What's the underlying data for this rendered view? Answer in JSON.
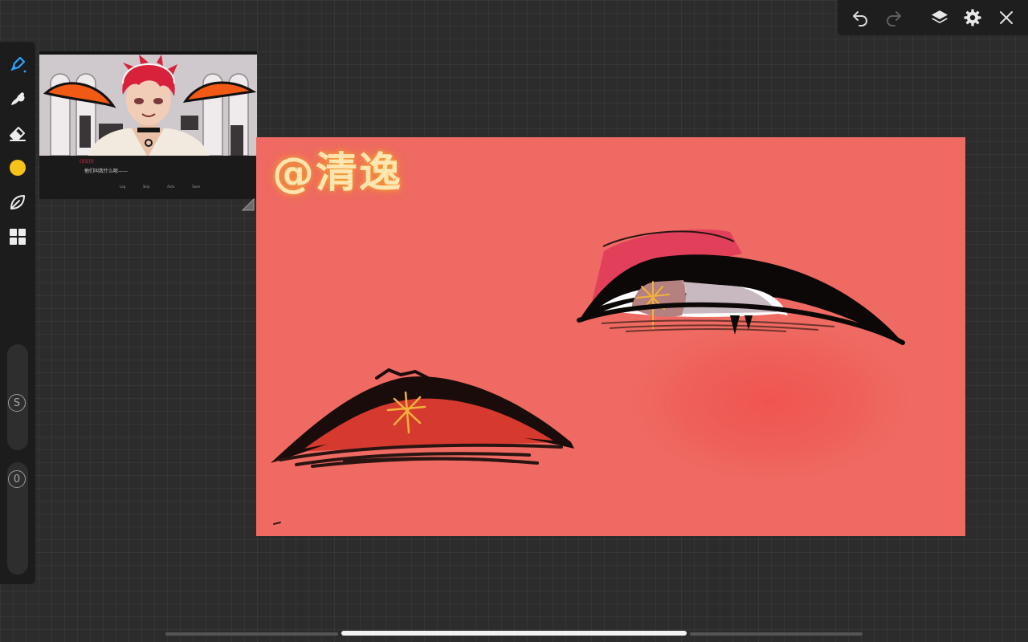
{
  "app": {
    "name": "drawing-app",
    "background_color": "#2c2c2c"
  },
  "top_toolbar": {
    "buttons": [
      {
        "name": "undo",
        "icon": "undo-arrow-icon",
        "enabled": true
      },
      {
        "name": "redo",
        "icon": "redo-arrow-icon",
        "enabled": false
      },
      {
        "name": "layers",
        "icon": "layers-icon",
        "enabled": true
      },
      {
        "name": "settings",
        "icon": "gear-icon",
        "enabled": true
      },
      {
        "name": "close",
        "icon": "close-icon",
        "enabled": true
      }
    ]
  },
  "left_toolbar": {
    "tools": [
      {
        "name": "pen",
        "icon": "pen-icon",
        "active": true,
        "color": "#2aa6ff"
      },
      {
        "name": "smudge",
        "icon": "smudge-finger-icon",
        "active": false
      },
      {
        "name": "eraser",
        "icon": "eraser-icon",
        "active": false
      },
      {
        "name": "color",
        "icon": "color-swatch",
        "active": false,
        "color": "#f6c21a"
      },
      {
        "name": "fill",
        "icon": "leaf-brush-icon",
        "active": false
      },
      {
        "name": "grid",
        "icon": "grid-tiles-icon",
        "active": false
      }
    ],
    "size_slider": {
      "label": "S"
    },
    "opacity_slider": {
      "label": "0"
    }
  },
  "reference_window": {
    "game_name_label": "(((S)))",
    "game_dialog_text": "他们叫我什么呢——",
    "game_menu": [
      "Log",
      "Skip",
      "Auto",
      "Save"
    ]
  },
  "canvas": {
    "background_color": "#ee6a62",
    "signature_text": "@清逸",
    "signature_color": "#ffe9b8"
  },
  "bottom_bar": {
    "active_index": 1
  }
}
